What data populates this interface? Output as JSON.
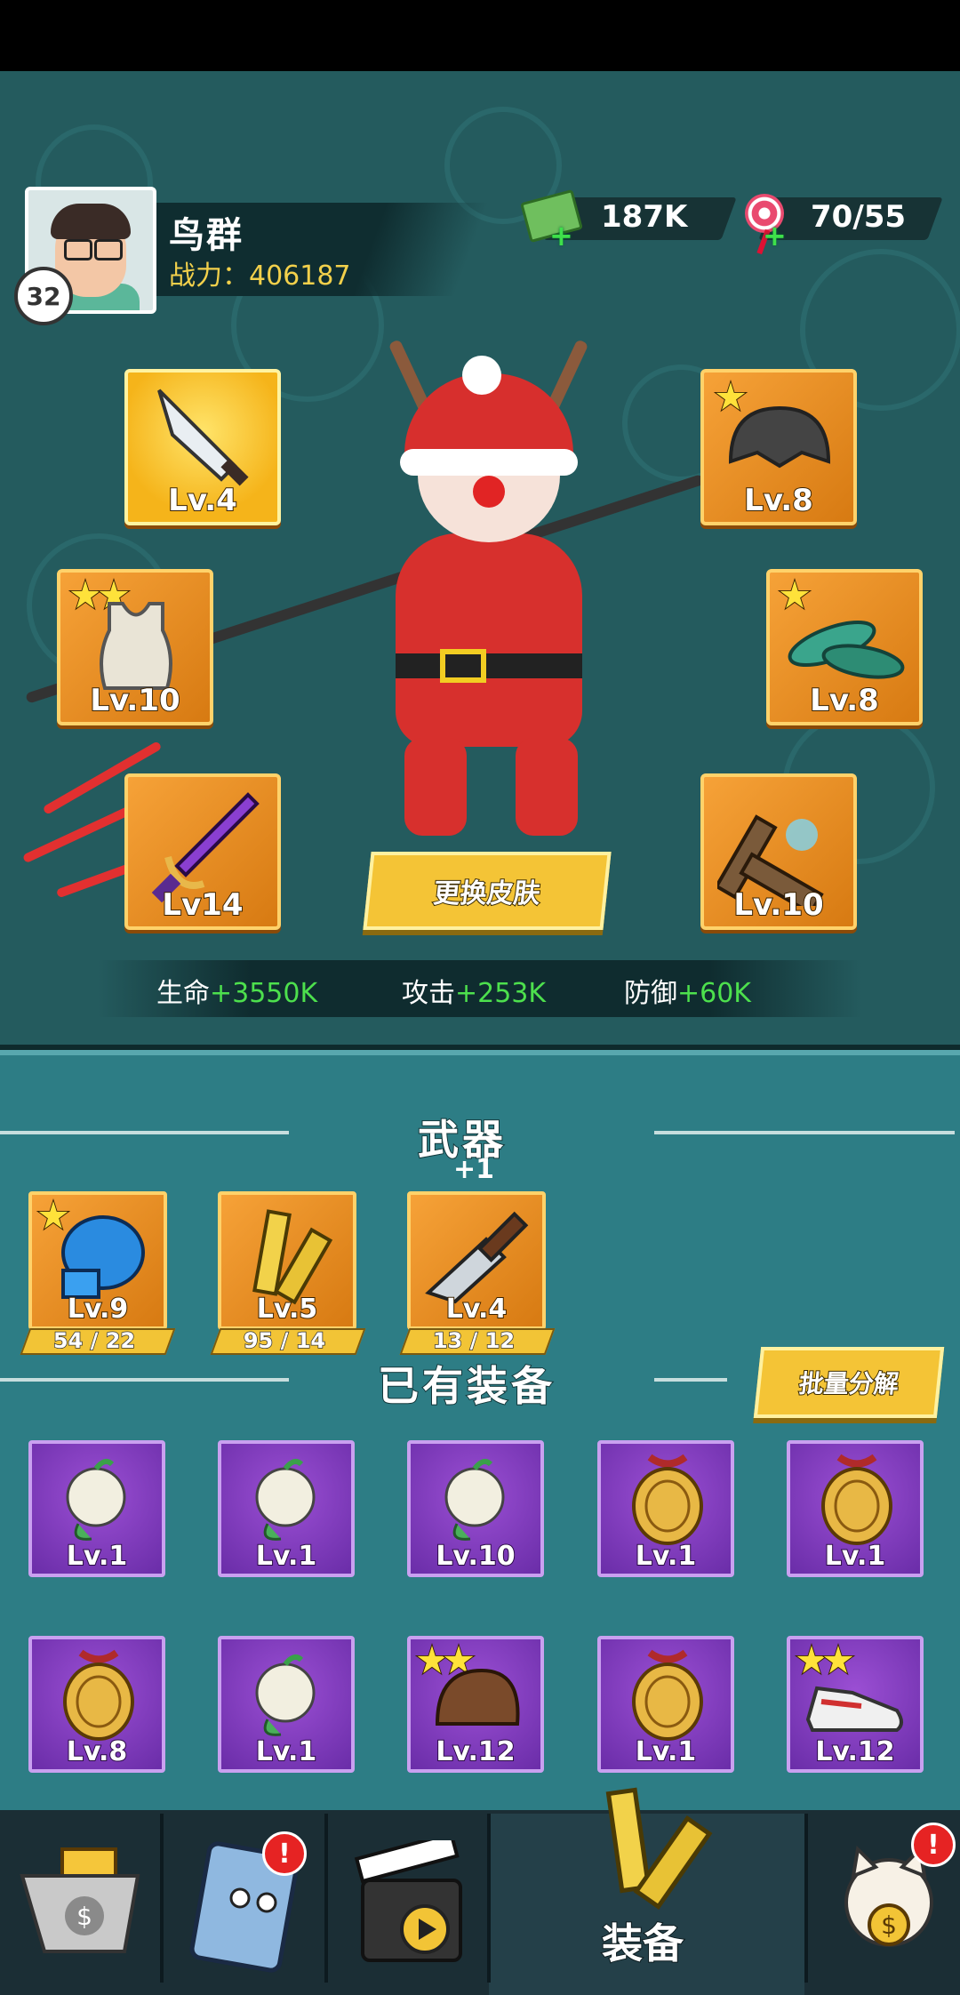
{
  "player": {
    "name": "鸟群",
    "level": "32",
    "power_label": "战力：",
    "power_value": "406187"
  },
  "currency": {
    "cash": "187K",
    "candy": "70/55"
  },
  "equipped": {
    "weapon_level": "Lv.4",
    "helmet_level": "Lv.8",
    "armor_level": "Lv.10",
    "shoes_level": "Lv.8",
    "sword_level": "Lv14",
    "nunchaku_level": "Lv.10"
  },
  "skin_button": "更换皮肤",
  "stats": {
    "hp_label": "生命",
    "hp_value": "+3550K",
    "atk_label": "攻击",
    "atk_value": "+253K",
    "def_label": "防御",
    "def_value": "+60K"
  },
  "weapons_section": {
    "title": "武器",
    "bonus": "+1",
    "items": [
      {
        "level": "Lv.9",
        "progress": "54 / 22",
        "icon": "boxing-glove-icon"
      },
      {
        "level": "Lv.5",
        "progress": "95 / 14",
        "icon": "nunchaku-icon"
      },
      {
        "level": "Lv.4",
        "progress": "13 / 12",
        "icon": "cleaver-icon"
      }
    ]
  },
  "inventory_section": {
    "title": "已有装备",
    "batch_button": "批量分解",
    "items": [
      {
        "level": "Lv.1",
        "icon": "sprout-icon"
      },
      {
        "level": "Lv.1",
        "icon": "sprout-icon"
      },
      {
        "level": "Lv.10",
        "icon": "sprout-icon"
      },
      {
        "level": "Lv.1",
        "icon": "medal-icon"
      },
      {
        "level": "Lv.1",
        "icon": "medal-icon"
      },
      {
        "level": "Lv.8",
        "icon": "medal-icon"
      },
      {
        "level": "Lv.1",
        "icon": "sprout-icon"
      },
      {
        "level": "Lv.12",
        "icon": "cap-icon"
      },
      {
        "level": "Lv.1",
        "icon": "medal-icon"
      },
      {
        "level": "Lv.12",
        "icon": "sneaker-icon"
      }
    ]
  },
  "nav": {
    "active_label": "装备",
    "badge_book": "!",
    "badge_cat": "!"
  },
  "colors": {
    "top_bg": "#245b5e",
    "bottom_bg": "#2d7d85",
    "slot_orange": "#f6a238",
    "slot_purple": "#6a2da8",
    "accent_gold": "#f4c436",
    "stat_green": "#4de04d"
  }
}
